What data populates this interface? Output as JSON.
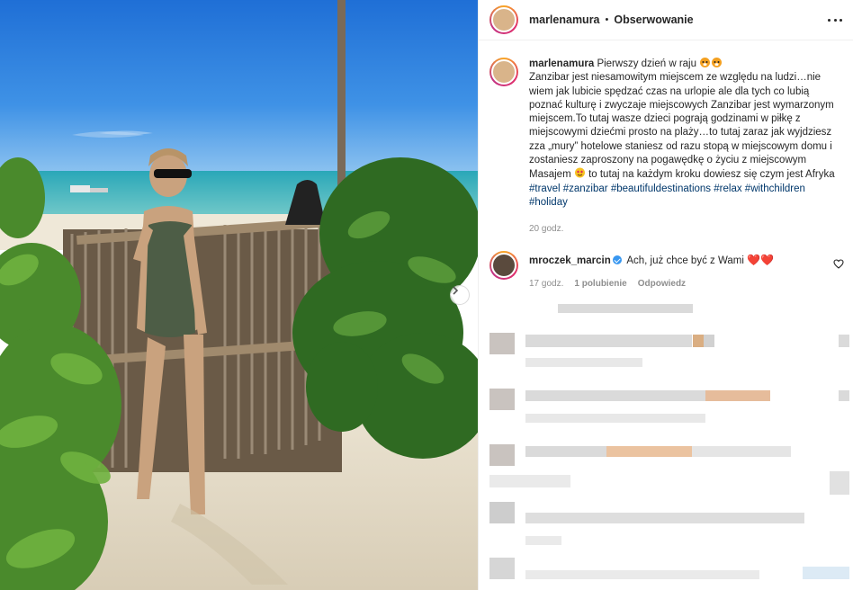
{
  "post_header": {
    "username": "marlenamura",
    "separator": "•",
    "follow_label": "Obserwowanie"
  },
  "caption": {
    "username": "marlenamura",
    "title_line": "Pierwszy dzień w raju",
    "body_part1": "Zanzibar jest niesamowitym miejscem ze względu na ludzi…nie wiem jak lubicie spędzać czas na urlopie ale dla tych co lubią poznać kulturę i zwyczaje miejscowych Zanzibar jest wymarzonym miejscem.To tutaj wasze dzieci pograją godzinami w piłkę z miejscowymi dziećmi prosto na plaży…to tutaj zaraz jak wyjdziesz zza „mury” hotelowe staniesz od razu stopą w miejscowym domu i zostaniesz zaproszony na pogawędkę o życiu z miejscowym Masajem",
    "body_part2": "to tutaj na każdym kroku dowiesz się czym jest Afryka",
    "hashtags": [
      "#travel",
      "#zanzibar",
      "#beautifuldestinations",
      "#relax",
      "#withchildren",
      "#holiday"
    ],
    "time": "20 godz."
  },
  "comment": {
    "username": "mroczek_marcin",
    "text": "Ach, już chce być z Wami",
    "hearts": "❤️❤️",
    "time": "17 godz.",
    "likes": "1 polubienie",
    "reply_label": "Odpowiedz"
  },
  "icons": {
    "more": "more-options-icon",
    "next": "chevron-right-icon",
    "like": "heart-outline-icon",
    "verified": "verified-badge-icon"
  },
  "colors": {
    "hashtag": "#00376b",
    "verified": "#3897f0",
    "heart": "#ed1c24",
    "meta": "#8e8e8e"
  }
}
